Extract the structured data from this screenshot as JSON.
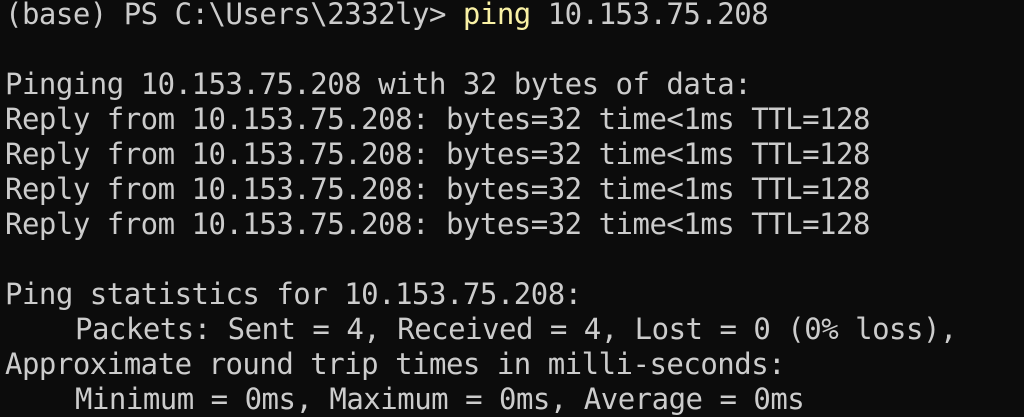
{
  "prompt": {
    "prefix": "(base) PS C:\\Users\\2332ly> ",
    "command": "ping",
    "argument": " 10.153.75.208"
  },
  "output": {
    "header": "Pinging 10.153.75.208 with 32 bytes of data:",
    "replies": [
      "Reply from 10.153.75.208: bytes=32 time<1ms TTL=128",
      "Reply from 10.153.75.208: bytes=32 time<1ms TTL=128",
      "Reply from 10.153.75.208: bytes=32 time<1ms TTL=128",
      "Reply from 10.153.75.208: bytes=32 time<1ms TTL=128"
    ],
    "stats_header": "Ping statistics for 10.153.75.208:",
    "packets": "Packets: Sent = 4, Received = 4, Lost = 0 (0% loss),",
    "rtt_header": "Approximate round trip times in milli-seconds:",
    "rtt_values": "Minimum = 0ms, Maximum = 0ms, Average = 0ms"
  },
  "colors": {
    "background": "#0c0c0c",
    "text": "#cccccc",
    "command": "#f9f1a5"
  }
}
